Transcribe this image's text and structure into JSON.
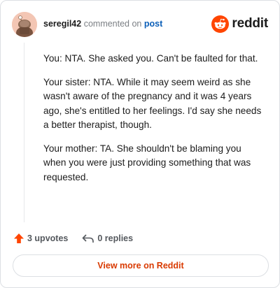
{
  "header": {
    "username": "seregil42",
    "commented_text": "commented on",
    "post_link": "post",
    "brand": "reddit"
  },
  "comment": {
    "paragraphs": [
      "You: NTA. She asked you. Can't be faulted for that.",
      "Your sister: NTA. While it may seem weird as she wasn't aware of the pregnancy and it was 4 years ago, she's entitled to her feelings. I'd say she needs a better therapist, though.",
      "Your mother: TA. She shouldn't be blaming you when you were just providing something that was requested."
    ]
  },
  "actions": {
    "upvotes": "3 upvotes",
    "replies": "0 replies"
  },
  "footer": {
    "view_more": "View more on Reddit"
  },
  "colors": {
    "accent": "#ff4500",
    "link": "#0b5fb8",
    "view_more_text": "#d93a00"
  }
}
